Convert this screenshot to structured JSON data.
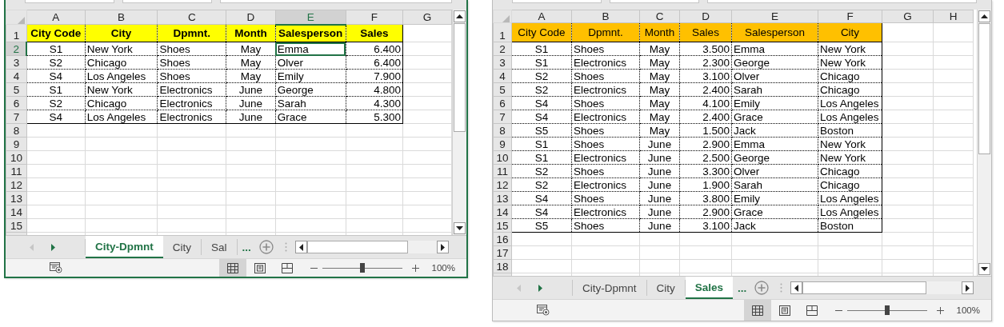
{
  "windows": [
    {
      "color": "#ffff00",
      "header_bold": true,
      "column_headers": [
        {
          "label": "A",
          "selected": false
        },
        {
          "label": "B",
          "selected": false
        },
        {
          "label": "C",
          "selected": false
        },
        {
          "label": "D",
          "selected": false
        },
        {
          "label": "E",
          "selected": true
        },
        {
          "label": "F",
          "selected": false
        },
        {
          "label": "G",
          "selected": false
        }
      ],
      "row_headers": [
        {
          "label": "1",
          "selected": false
        },
        {
          "label": "2",
          "selected": true
        },
        {
          "label": "3",
          "selected": false
        },
        {
          "label": "4",
          "selected": false
        },
        {
          "label": "5",
          "selected": false
        },
        {
          "label": "6",
          "selected": false
        },
        {
          "label": "7",
          "selected": false
        },
        {
          "label": "8",
          "selected": false
        },
        {
          "label": "9",
          "selected": false
        },
        {
          "label": "10",
          "selected": false
        },
        {
          "label": "11",
          "selected": false
        },
        {
          "label": "12",
          "selected": false
        },
        {
          "label": "13",
          "selected": false
        },
        {
          "label": "14",
          "selected": false
        },
        {
          "label": "15",
          "selected": false
        }
      ],
      "table": {
        "columns": [
          {
            "label": "City Code",
            "kind": "centered"
          },
          {
            "label": "City",
            "kind": "text"
          },
          {
            "label": "Dpmnt.",
            "kind": "text"
          },
          {
            "label": "Month",
            "kind": "centered"
          },
          {
            "label": "Salesperson",
            "kind": "text"
          },
          {
            "label": "Sales",
            "kind": "number"
          }
        ],
        "rows": [
          [
            "S1",
            "New York",
            "Shoes",
            "May",
            "Emma",
            "6.400"
          ],
          [
            "S2",
            "Chicago",
            "Shoes",
            "May",
            "Olver",
            "6.400"
          ],
          [
            "S4",
            "Los Angeles",
            "Shoes",
            "May",
            "Emily",
            "7.900"
          ],
          [
            "S1",
            "New York",
            "Electronics",
            "June",
            "George",
            "4.800"
          ],
          [
            "S2",
            "Chicago",
            "Electronics",
            "June",
            "Sarah",
            "4.300"
          ],
          [
            "S4",
            "Los Angeles",
            "Electronics",
            "June",
            "Grace",
            "5.300"
          ]
        ]
      },
      "nav": [
        {
          "kind": "prev",
          "disabled": true
        },
        {
          "kind": "next",
          "disabled": false
        }
      ],
      "sheet_tabs": [
        {
          "label": "City-Dpmnt",
          "selected": true
        },
        {
          "label": "City",
          "selected": false
        },
        {
          "label": "Sal",
          "selected": false
        }
      ],
      "more_tabs": "...",
      "views": [
        {
          "kind": "normal",
          "selected": true
        },
        {
          "kind": "page-layout",
          "selected": false
        },
        {
          "kind": "page-break",
          "selected": false
        }
      ],
      "zoom": {
        "level": 0.5,
        "label": "100%"
      }
    },
    {
      "color": "#ffc000",
      "header_bold": false,
      "column_headers": [
        {
          "label": "A",
          "selected": false
        },
        {
          "label": "B",
          "selected": false
        },
        {
          "label": "C",
          "selected": false
        },
        {
          "label": "D",
          "selected": false
        },
        {
          "label": "E",
          "selected": false
        },
        {
          "label": "F",
          "selected": false
        },
        {
          "label": "G",
          "selected": false
        },
        {
          "label": "H",
          "selected": false
        }
      ],
      "row_headers": [
        {
          "label": "1",
          "selected": false
        },
        {
          "label": "2",
          "selected": false
        },
        {
          "label": "3",
          "selected": false
        },
        {
          "label": "4",
          "selected": false
        },
        {
          "label": "5",
          "selected": false
        },
        {
          "label": "6",
          "selected": false
        },
        {
          "label": "7",
          "selected": false
        },
        {
          "label": "8",
          "selected": false
        },
        {
          "label": "9",
          "selected": false
        },
        {
          "label": "10",
          "selected": false
        },
        {
          "label": "11",
          "selected": false
        },
        {
          "label": "12",
          "selected": false
        },
        {
          "label": "13",
          "selected": false
        },
        {
          "label": "14",
          "selected": false
        },
        {
          "label": "15",
          "selected": false
        },
        {
          "label": "16",
          "selected": false
        },
        {
          "label": "17",
          "selected": false
        },
        {
          "label": "18",
          "selected": false
        }
      ],
      "table": {
        "columns": [
          {
            "label": "City Code",
            "kind": "centered"
          },
          {
            "label": "Dpmnt.",
            "kind": "text"
          },
          {
            "label": "Month",
            "kind": "centered"
          },
          {
            "label": "Sales",
            "kind": "number"
          },
          {
            "label": "Salesperson",
            "kind": "text"
          },
          {
            "label": "City",
            "kind": "text"
          }
        ],
        "rows": [
          [
            "S1",
            "Shoes",
            "May",
            "3.500",
            "Emma",
            "New York"
          ],
          [
            "S1",
            "Electronics",
            "May",
            "2.300",
            "George",
            "New York"
          ],
          [
            "S2",
            "Shoes",
            "May",
            "3.100",
            "Olver",
            "Chicago"
          ],
          [
            "S2",
            "Electronics",
            "May",
            "2.400",
            "Sarah",
            "Chicago"
          ],
          [
            "S4",
            "Shoes",
            "May",
            "4.100",
            "Emily",
            "Los Angeles"
          ],
          [
            "S4",
            "Electronics",
            "May",
            "2.400",
            "Grace",
            "Los Angeles"
          ],
          [
            "S5",
            "Shoes",
            "May",
            "1.500",
            "Jack",
            "Boston"
          ],
          [
            "S1",
            "Shoes",
            "June",
            "2.900",
            "Emma",
            "New York"
          ],
          [
            "S1",
            "Electronics",
            "June",
            "2.500",
            "George",
            "New York"
          ],
          [
            "S2",
            "Shoes",
            "June",
            "3.300",
            "Olver",
            "Chicago"
          ],
          [
            "S2",
            "Electronics",
            "June",
            "1.900",
            "Sarah",
            "Chicago"
          ],
          [
            "S4",
            "Shoes",
            "June",
            "3.800",
            "Emily",
            "Los Angeles"
          ],
          [
            "S4",
            "Electronics",
            "June",
            "2.900",
            "Grace",
            "Los Angeles"
          ],
          [
            "S5",
            "Shoes",
            "June",
            "3.100",
            "Jack",
            "Boston"
          ]
        ]
      },
      "nav": [
        {
          "kind": "prev",
          "disabled": true
        },
        {
          "kind": "next",
          "disabled": false
        }
      ],
      "sheet_tabs": [
        {
          "label": "City-Dpmnt",
          "selected": false
        },
        {
          "label": "City",
          "selected": false
        },
        {
          "label": "Sales",
          "selected": true
        }
      ],
      "more_tabs": "...",
      "views": [
        {
          "kind": "normal",
          "selected": true
        },
        {
          "kind": "page-layout",
          "selected": false
        },
        {
          "kind": "page-break",
          "selected": false
        }
      ],
      "zoom": {
        "level": 0.5,
        "label": "100%"
      }
    }
  ]
}
